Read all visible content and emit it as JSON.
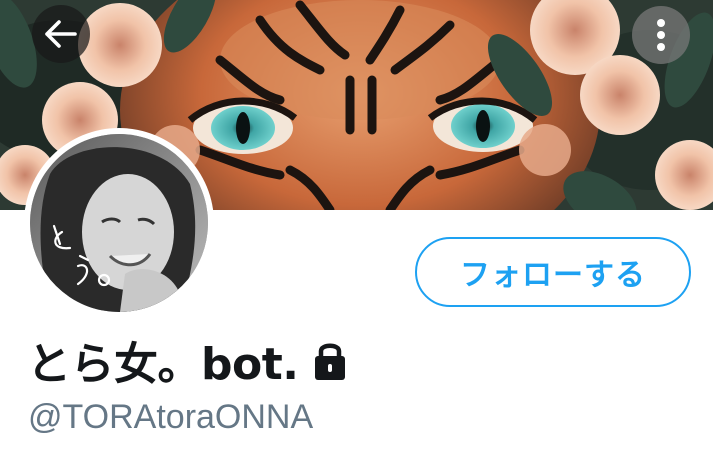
{
  "header": {
    "back_icon": "arrow-left-icon",
    "more_icon": "more-vertical-icon"
  },
  "profile": {
    "display_name": "とら女。bot.",
    "handle": "@TORAtoraONNA",
    "protected_icon": "lock-icon",
    "follow_label": "フォローする",
    "avatar_scribble": "とら。"
  },
  "colors": {
    "accent": "#1da1f2",
    "name": "#14171a",
    "handle": "#657786"
  }
}
